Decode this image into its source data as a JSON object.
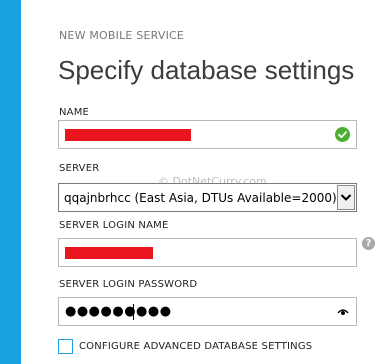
{
  "wizard": {
    "subtitle": "NEW MOBILE SERVICE",
    "title": "Specify database settings"
  },
  "fields": {
    "name": {
      "label": "NAME",
      "value_redacted": true,
      "status_icon": "checkmark-circle-icon"
    },
    "server": {
      "label": "SERVER",
      "selected": "qqajnbrhcc (East Asia, DTUs Available=2000)"
    },
    "server_login_name": {
      "label": "SERVER LOGIN NAME",
      "value_redacted": true,
      "help_icon": "?"
    },
    "server_login_password": {
      "label": "SERVER LOGIN PASSWORD",
      "masked_value": "●●●●●●●●●",
      "reveal_icon": "eye-icon"
    }
  },
  "advanced": {
    "checked": false,
    "label": "CONFIGURE ADVANCED DATABASE SETTINGS"
  },
  "watermark": "© DotNetCurry.com",
  "colors": {
    "accent": "#1aa1e1",
    "redaction": "#e8151f",
    "success": "#4caf31",
    "help": "#a8a8a8"
  }
}
